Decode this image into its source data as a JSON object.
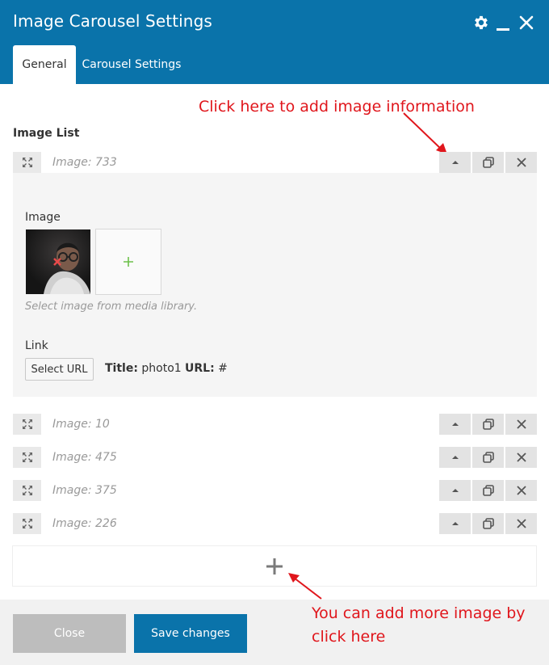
{
  "window": {
    "title": "Image Carousel Settings",
    "icons": [
      "gear-icon",
      "minimize-icon",
      "close-icon"
    ]
  },
  "tabs": [
    {
      "label": "General",
      "active": true
    },
    {
      "label": "Carousel Settings",
      "active": false
    }
  ],
  "annotations": {
    "top": "Click here to add image information",
    "bottom": "You can add more image by click here"
  },
  "image_list": {
    "label": "Image List",
    "items": [
      {
        "name": "Image: 733",
        "expanded": true
      },
      {
        "name": "Image: 10"
      },
      {
        "name": "Image: 475"
      },
      {
        "name": "Image: 375"
      },
      {
        "name": "Image: 226"
      }
    ]
  },
  "panel": {
    "image_label": "Image",
    "hint": "Select image from media library.",
    "link_label": "Link",
    "select_url_button": "Select URL",
    "title_label": "Title:",
    "title_value": "photo1",
    "url_label": "URL:",
    "url_value": "#"
  },
  "footer": {
    "close_label": "Close",
    "save_label": "Save changes"
  },
  "colors": {
    "brand": "#0a73aa",
    "annotation": "#e0161c",
    "add_plus": "#6cc04a",
    "close_button": "#bdbdbd"
  }
}
